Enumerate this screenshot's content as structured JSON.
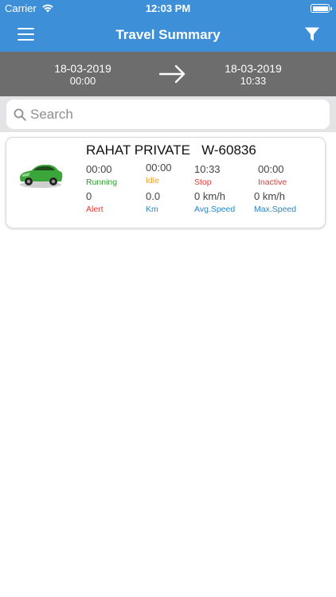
{
  "status_bar": {
    "carrier": "Carrier",
    "time": "12:03 PM"
  },
  "nav": {
    "title": "Travel Summary",
    "left_icon": "hamburger-menu-icon",
    "right_icon": "filter-icon",
    "bar_color": "#3d8fd8"
  },
  "date_range": {
    "from_date": "18-03-2019",
    "from_time": "00:00",
    "to_date": "18-03-2019",
    "to_time": "10:33",
    "arrow_icon": "arrow-right-icon"
  },
  "search": {
    "placeholder": "Search",
    "value": ""
  },
  "vehicle": {
    "name": "RAHAT PRIVATE   W-60836",
    "icon": "green-car-icon",
    "stats": {
      "running": {
        "value": "00:00",
        "label": "Running",
        "color": "#2e9a2e"
      },
      "idle": {
        "value": "00:00",
        "label": "Idle",
        "color": "#f0a02a"
      },
      "stop": {
        "value": "10:33",
        "label": "Stop",
        "color": "#e53935"
      },
      "inactive": {
        "value": "00:00",
        "label": "Inactive",
        "color": "#e53935"
      },
      "alert": {
        "value": "0",
        "label": "Alert",
        "color": "#e53935"
      },
      "km": {
        "value": "0.0",
        "label": "Km",
        "color": "#2a86c8"
      },
      "avg_speed": {
        "value": "0 km/h",
        "label": "Avg.Speed",
        "color": "#2a86c8"
      },
      "max_speed": {
        "value": "0 km/h",
        "label": "Max.Speed",
        "color": "#2a86c8"
      }
    }
  }
}
